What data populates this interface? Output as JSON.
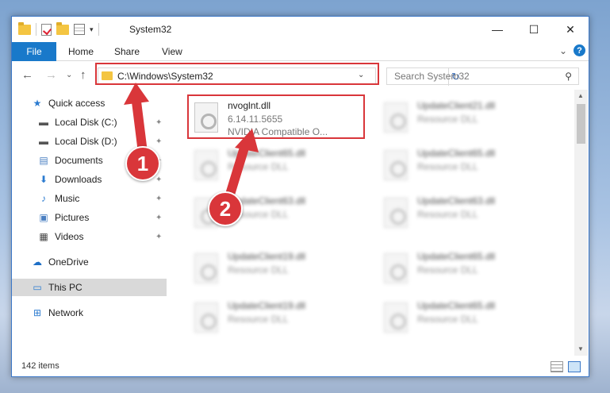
{
  "window": {
    "title": "System32"
  },
  "titlebar": {
    "minimize": "—",
    "maximize": "☐",
    "close": "✕"
  },
  "ribbon": {
    "tabs": [
      "File",
      "Home",
      "Share",
      "View"
    ],
    "expand_glyph": "⌄",
    "help": "?"
  },
  "nav": {
    "back": "←",
    "forward": "→",
    "recent": "⌄",
    "up": "↑"
  },
  "address": {
    "path": "C:\\Windows\\System32",
    "dropdown": "⌄",
    "refresh": "↻"
  },
  "search": {
    "placeholder": "Search System32",
    "icon": "⚲"
  },
  "sidebar": {
    "items": [
      {
        "label": "Quick access",
        "icon": "star-icon",
        "glyph": "★",
        "color": "#2b7bd0"
      },
      {
        "label": "Local Disk (C:)",
        "icon": "drive-icon",
        "glyph": "▬",
        "color": "#555555",
        "pinned": true
      },
      {
        "label": "Local Disk (D:)",
        "icon": "drive-icon",
        "glyph": "▬",
        "color": "#555555",
        "pinned": true
      },
      {
        "label": "Documents",
        "icon": "documents-icon",
        "glyph": "▤",
        "color": "#4a7fc1",
        "pinned": true
      },
      {
        "label": "Downloads",
        "icon": "downloads-icon",
        "glyph": "⬇",
        "color": "#2b7bd0",
        "pinned": true
      },
      {
        "label": "Music",
        "icon": "music-icon",
        "glyph": "♪",
        "color": "#2b7bd0",
        "pinned": true
      },
      {
        "label": "Pictures",
        "icon": "pictures-icon",
        "glyph": "▣",
        "color": "#4a7fc1",
        "pinned": true
      },
      {
        "label": "Videos",
        "icon": "videos-icon",
        "glyph": "▦",
        "color": "#444444",
        "pinned": true
      },
      {
        "label": "OneDrive",
        "icon": "cloud-icon",
        "glyph": "☁",
        "color": "#1e6fc6"
      },
      {
        "label": "This PC",
        "icon": "computer-icon",
        "glyph": "▭",
        "color": "#2b7bd0",
        "selected": true
      },
      {
        "label": "Network",
        "icon": "network-icon",
        "glyph": "⊞",
        "color": "#2b7bd0"
      }
    ],
    "pin_glyph": "📌"
  },
  "files": {
    "featured": {
      "name": "nvoglnt.dll",
      "version": "6.14.11.5655",
      "description": "NVIDIA Compatible O..."
    },
    "blurred": [
      {
        "name": "UpdateClient21.dll",
        "type": "Resource DLL"
      },
      {
        "name": "UpdateClient65.dll",
        "type": "Resource DLL"
      },
      {
        "name": "UpdateClient65.dll",
        "type": "Resource DLL"
      },
      {
        "name": "UpdateClient63.dll",
        "type": "Resource DLL"
      },
      {
        "name": "UpdateClient63.dll",
        "type": "Resource DLL"
      },
      {
        "name": "UpdateClient19.dll",
        "type": "Resource DLL"
      },
      {
        "name": "UpdateClient65.dll",
        "type": "Resource DLL"
      },
      {
        "name": "UpdateClient19.dll",
        "type": "Resource DLL"
      },
      {
        "name": "UpdateClient65.dll",
        "type": "Resource DLL"
      }
    ]
  },
  "status": {
    "count": "142 items"
  },
  "annotations": {
    "step1": "1",
    "step2": "2",
    "color": "#d9363a"
  }
}
